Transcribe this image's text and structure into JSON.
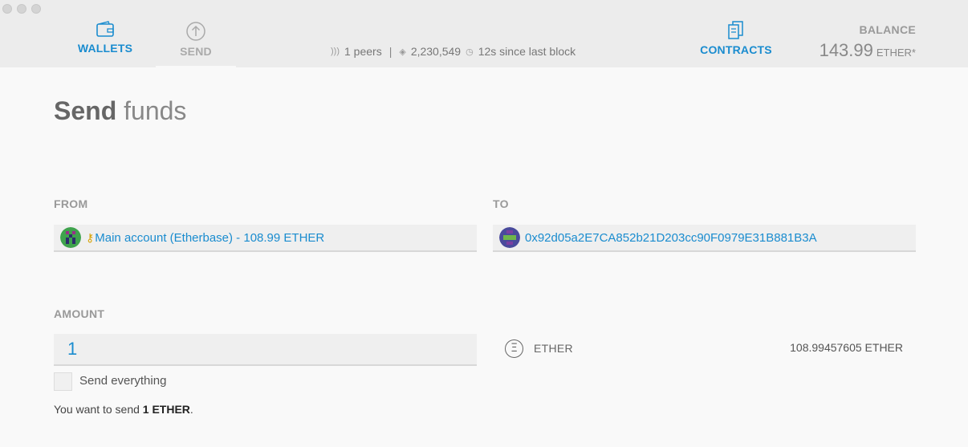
{
  "nav": {
    "wallets_label": "WALLETS",
    "send_label": "SEND",
    "contracts_label": "CONTRACTS"
  },
  "status": {
    "peers": "1 peers",
    "separator": "|",
    "block": "2,230,549",
    "since": "12s since last block"
  },
  "balance": {
    "label": "BALANCE",
    "value": "143.99",
    "unit": "ETHER*"
  },
  "page": {
    "title_bold": "Send",
    "title_light": "funds"
  },
  "from": {
    "label": "FROM",
    "value": "Main account (Etherbase) - 108.99 ETHER",
    "identicon_color": "#3fa34d"
  },
  "to": {
    "label": "TO",
    "value": "0x92d05a2E7CA852b21D203cc90F0979E31B881B3A",
    "identicon_color": "#4a4a9c"
  },
  "amount": {
    "label": "AMOUNT",
    "value": "1",
    "send_everything_label": "Send everything"
  },
  "currency": {
    "icon_glyph": "Ξ",
    "name": "ETHER",
    "available": "108.99457605 ETHER"
  },
  "summary": {
    "prefix": "You want to send ",
    "amount": "1 ETHER",
    "suffix": "."
  },
  "colors": {
    "accent": "#1a8ccf",
    "topbar": "#ececec",
    "background": "#f9f9f9"
  }
}
